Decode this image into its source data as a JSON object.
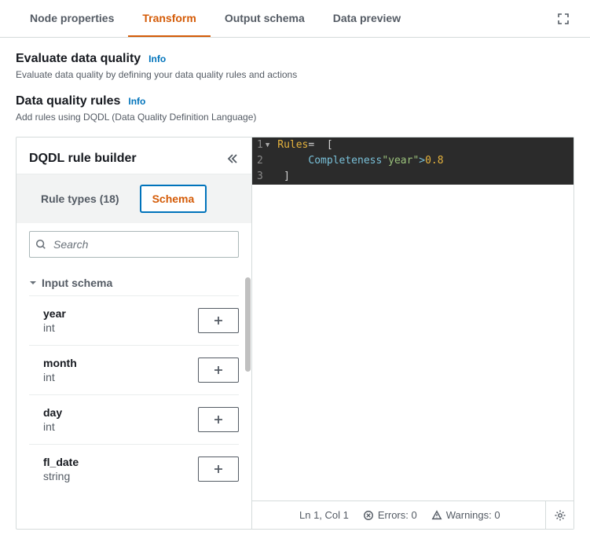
{
  "tabs": [
    {
      "label": "Node properties",
      "active": false
    },
    {
      "label": "Transform",
      "active": true
    },
    {
      "label": "Output schema",
      "active": false
    },
    {
      "label": "Data preview",
      "active": false
    }
  ],
  "sections": {
    "evaluate": {
      "title": "Evaluate data quality",
      "info": "Info",
      "desc": "Evaluate data quality by defining your data quality rules and actions"
    },
    "rules": {
      "title": "Data quality rules",
      "info": "Info",
      "desc": "Add rules using DQDL (Data Quality Definition Language)"
    }
  },
  "builder": {
    "title": "DQDL rule builder",
    "inner_tabs": [
      {
        "label": "Rule types (18)",
        "active": false
      },
      {
        "label": "Schema",
        "active": true
      }
    ],
    "search_placeholder": "Search",
    "group_title": "Input schema",
    "fields": [
      {
        "name": "year",
        "type": "int"
      },
      {
        "name": "month",
        "type": "int"
      },
      {
        "name": "day",
        "type": "int"
      },
      {
        "name": "fl_date",
        "type": "string"
      }
    ]
  },
  "editor": {
    "lines": [
      {
        "n": "1",
        "fold": true
      },
      {
        "n": "2"
      },
      {
        "n": "3"
      }
    ],
    "code": {
      "l1_keyword": "Rules",
      "l1_eq": "=",
      "l1_open": "  [",
      "l2_indent": "     ",
      "l2_func": "Completeness",
      "l2_str": "\"year\"",
      "l2_op": ">",
      "l2_num": "0.8",
      "l3_close": " ]"
    }
  },
  "status": {
    "pos": "Ln 1, Col 1",
    "errors": "Errors: 0",
    "warnings": "Warnings: 0"
  }
}
